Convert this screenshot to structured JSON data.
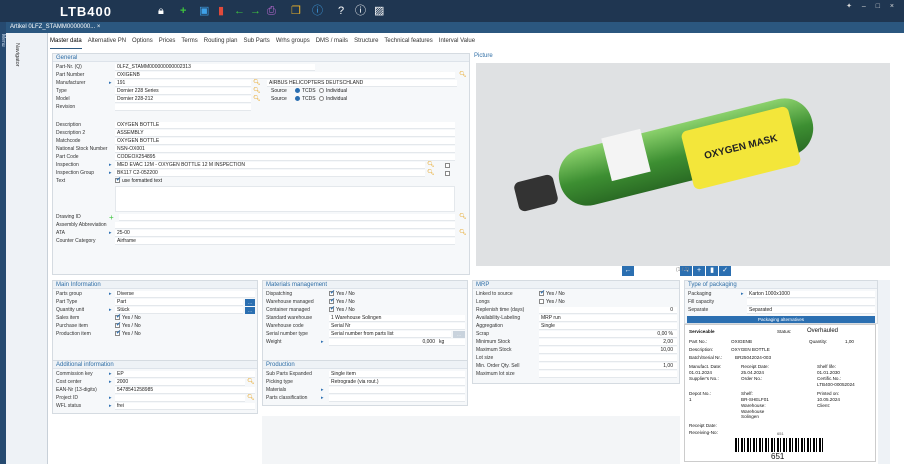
{
  "app": {
    "logo": "LTB400",
    "window_controls": "✦ – □ ×"
  },
  "side": {
    "label": "Menu"
  },
  "title": {
    "tab": "Artikel 0LFZ_STAMM0000000... ×"
  },
  "navigator": "Navigator",
  "menu": [
    "Master data",
    "Alternative PN",
    "Options",
    "Prices",
    "Terms",
    "Routing plan",
    "Sub Parts",
    "Wrhs groups",
    "DMS / mails",
    "Structure",
    "Technical features",
    "Interval Value"
  ],
  "general": {
    "title": "General",
    "part_nr_sq_label": "Part-Nr. (Q)",
    "part_nr_sq": "0LFZ_STAMM000000000002313",
    "part_number_label": "Part Number",
    "part_number": "OXIGENB",
    "manufacturer_label": "Manufacturer",
    "manufacturer": "191",
    "manufacturer_name": "AIRBUS HELICOPTERS DEUTSCHLAND",
    "type_label": "Type",
    "type": "Dornier 228 Series",
    "model_label": "Model",
    "model": "Dornier 228-212",
    "revision_label": "Revision",
    "source_label": "Source",
    "tcds": "TCDS",
    "individual": "Individual",
    "description_label": "Description",
    "description": "OXYGEN BOTTLE",
    "description2_label": "Description 2",
    "description2": "ASSEMBLY",
    "matchcode_label": "Matchcode",
    "matchcode": "OXYGEN BOTTLE",
    "nsn_label": "National Stock Number",
    "nsn": "NSN-OX001",
    "part_code_label": "Part Code",
    "part_code": "CODEOX254895",
    "inspection_label": "Inspection",
    "inspection": "MED EVAC 12M - OXYGEN BOTTLE 12 M INSPECTION",
    "inspection_group_label": "Inspection Group",
    "inspection_group": "BK117 C2-052200",
    "text_label": "Text",
    "use_formatted": "use formatted text",
    "drawing_label": "Drawing ID",
    "assembly_label": "Assembly Abbreviation",
    "ata_label": "ATA",
    "ata": "25-00",
    "counter_label": "Counter Category",
    "counter": "Airframe"
  },
  "picture": {
    "title": "Picture",
    "bag_text": "OXYGEN MASK",
    "counter": "(1 / 1)"
  },
  "main_info": {
    "title": "Main Information",
    "rows": [
      {
        "label": "Parts group",
        "value": "Diverse"
      },
      {
        "label": "Part Type",
        "value": "Part"
      },
      {
        "label": "Quantity unit",
        "value": "Stück"
      },
      {
        "label": "Sales item",
        "value": "Yes / No"
      },
      {
        "label": "Purchase item",
        "value": "Yes / No"
      },
      {
        "label": "Production item",
        "value": "Yes / No"
      }
    ]
  },
  "materials": {
    "title": "Materials management",
    "rows": [
      {
        "label": "Dispatching",
        "value": "Yes / No"
      },
      {
        "label": "Warehouse managed",
        "value": "Yes / No"
      },
      {
        "label": "Container managed",
        "value": "Yes / No"
      },
      {
        "label": "Standard warehouse",
        "value": "1  Warehouse Solingen"
      },
      {
        "label": "Warehouse code",
        "value": "Serial Nr"
      },
      {
        "label": "Serial number type",
        "value": "Serial number from parts list"
      },
      {
        "label": "Weight",
        "value": "0,000",
        "unit": "kg"
      }
    ]
  },
  "mrp": {
    "title": "MRP",
    "rows": [
      {
        "label": "Linked to source",
        "value": "Yes / No"
      },
      {
        "label": "Longs",
        "value": "Yes / No"
      },
      {
        "label": "Replenish time (days)",
        "value": "0"
      },
      {
        "label": "Availability-Labeling",
        "value": "MRP run"
      },
      {
        "label": "Aggregation",
        "value": "Single"
      },
      {
        "label": "Scrap",
        "value": "0,00 %"
      },
      {
        "label": "Minimum Stock",
        "value": "2,00"
      },
      {
        "label": "Maximum Stock",
        "value": "10,00"
      },
      {
        "label": "Lot size",
        "value": ""
      },
      {
        "label": "Min. Order Qty. Sell",
        "value": "1,00"
      },
      {
        "label": "Maximum lot size",
        "value": ""
      }
    ]
  },
  "packaging": {
    "title": "Type of packaging",
    "rows": [
      {
        "label": "Packaging",
        "value": "Karton 1000x1000"
      },
      {
        "label": "Fill capacity",
        "value": ""
      },
      {
        "label": "Separate",
        "value": "Separated"
      }
    ],
    "alternatives_btn": "Packaging alternatives"
  },
  "additional": {
    "title": "Additional information",
    "rows": [
      {
        "label": "Commission key",
        "value": "EP"
      },
      {
        "label": "Cost center",
        "value": "2000"
      },
      {
        "label": "EAN-Nr (13-digits)",
        "value": "5478541258985"
      },
      {
        "label": "Project ID",
        "value": ""
      },
      {
        "label": "WFL status",
        "value": "frei"
      }
    ]
  },
  "production": {
    "title": "Production",
    "rows": [
      {
        "label": "Sub Parts Expanded",
        "value": "Single item"
      },
      {
        "label": "Picking type",
        "value": "Retrograde (via rout.)"
      },
      {
        "label": "Materials",
        "value": ""
      },
      {
        "label": "Parts classification",
        "value": ""
      }
    ]
  },
  "tag": {
    "serviceable": "Serviceable",
    "status_label": "Status:",
    "status": "Overhauled",
    "part_no_label": "Part No.:",
    "part_no": "OXIGENB",
    "quantity_label": "Quantity:",
    "quantity": "1,00",
    "desc_label": "Description:",
    "desc": "OXYGEN BOTTLE",
    "batch_label": "Batch/Serial Nr.:",
    "batch": "BR25042024-003",
    "manufact_label": "Manufact. Date:",
    "manufact": "01.01.2024",
    "receipt_label": "Receipt Date:",
    "receipt": "25.04.2024",
    "shelf_label": "Shelf life:",
    "shelf": "01.01.2030",
    "supplier_label": "Supplier's No.:",
    "order_label": "Order No.:",
    "certific_label": "Certific.No.:",
    "certific": "LTB400-00052024",
    "depot_label": "Depot No.:",
    "depot": "1",
    "shelf2_label": "Shelf:",
    "shelf2": "BR-SHELF01",
    "printed_label": "Printed on:",
    "printed": "10.05.2024",
    "warehouse_label": "Warehouse:",
    "warehouse": "Warehouse Solingen",
    "client_label": "Client:",
    "receipt_date_label": "Receipt Date:",
    "receiving_label": "Receiving-No:",
    "receiving_small": "651",
    "barcode_num": "651"
  },
  "colors": {
    "topbar": "#1f3651",
    "accent": "#2b6fb1",
    "titlebar": "#2b577f",
    "magnifier": "#e7a21b"
  }
}
